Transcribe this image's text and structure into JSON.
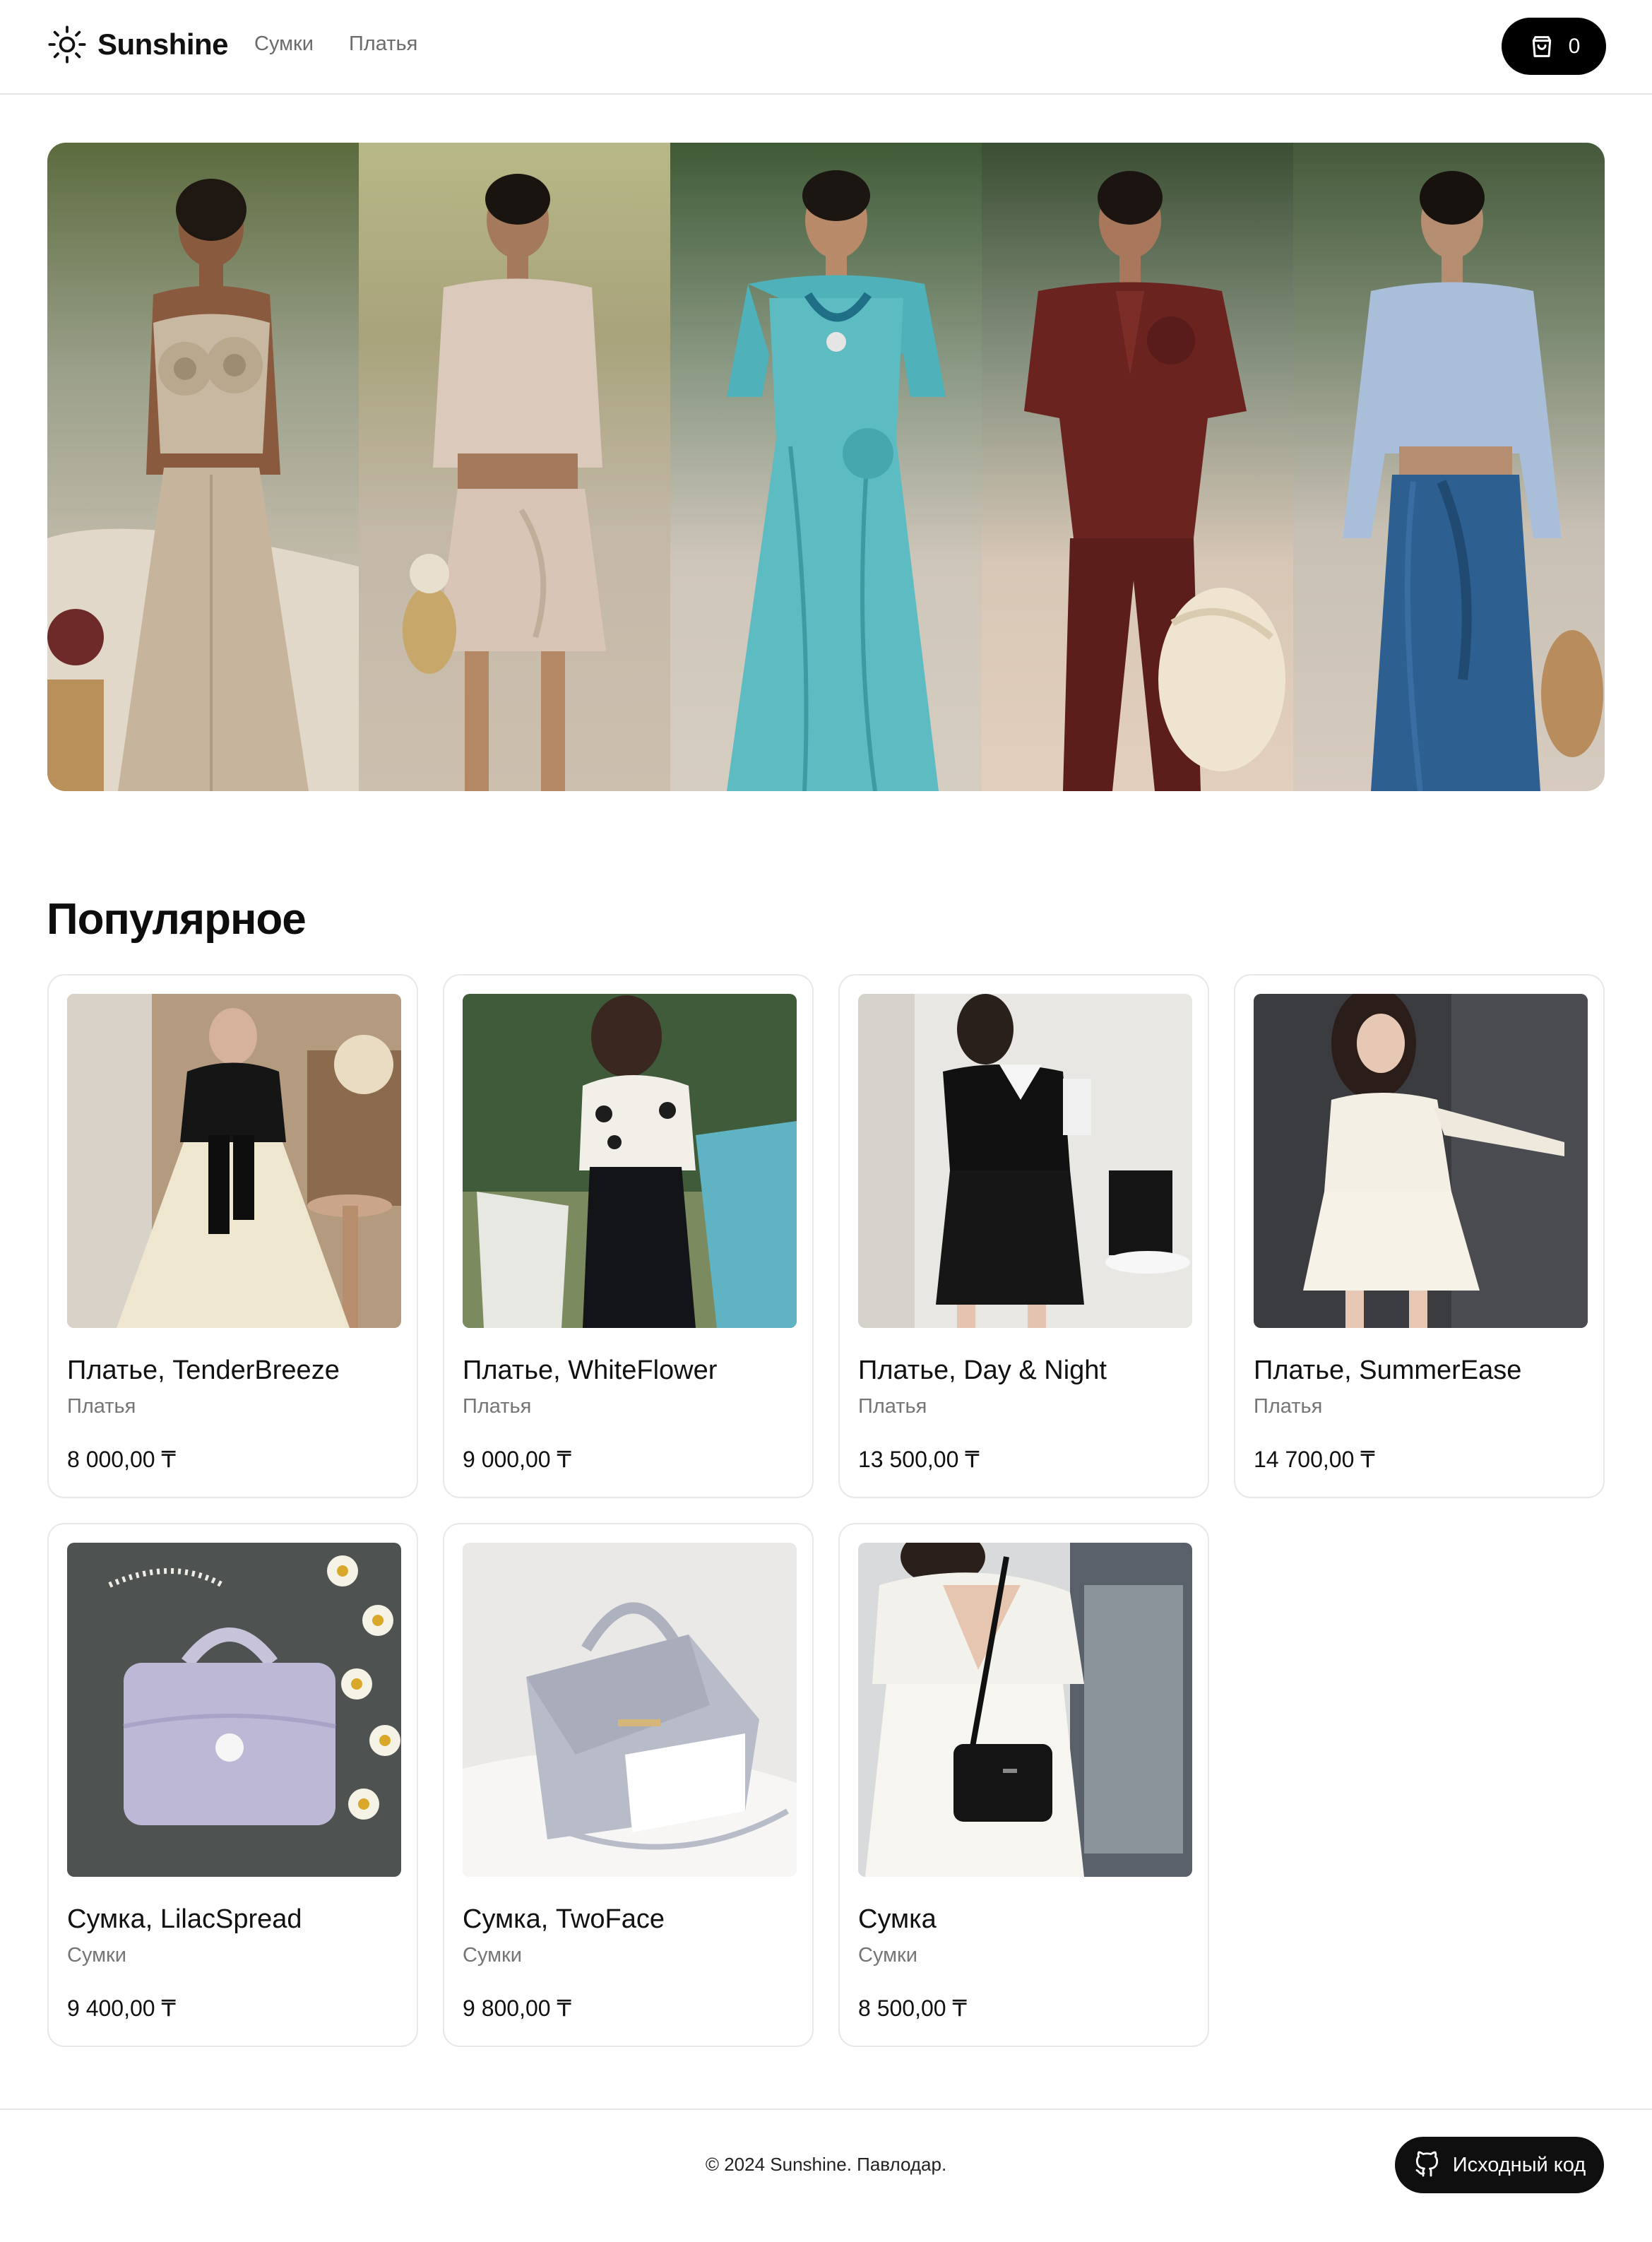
{
  "header": {
    "brand": "Sunshine",
    "nav": [
      "Сумки",
      "Платья"
    ],
    "cart_count": "0"
  },
  "section_title": "Популярное",
  "products": [
    {
      "name": "Платье, TenderBreeze",
      "category": "Платья",
      "price": "8 000,00 ₸"
    },
    {
      "name": "Платье, WhiteFlower",
      "category": "Платья",
      "price": "9 000,00 ₸"
    },
    {
      "name": "Платье, Day & Night",
      "category": "Платья",
      "price": "13 500,00 ₸"
    },
    {
      "name": "Платье, SummerEase",
      "category": "Платья",
      "price": "14 700,00 ₸"
    },
    {
      "name": "Сумка, LilacSpread",
      "category": "Сумки",
      "price": "9 400,00 ₸"
    },
    {
      "name": "Сумка, TwoFace",
      "category": "Сумки",
      "price": "9 800,00 ₸"
    },
    {
      "name": "Сумка",
      "category": "Сумки",
      "price": "8 500,00 ₸"
    }
  ],
  "footer": {
    "copyright": "© 2024 Sunshine. Павлодар.",
    "source_label": "Исходный код"
  },
  "icons": {
    "logo": "sun-icon",
    "cart": "shopping-bag-icon",
    "source": "github-icon"
  }
}
